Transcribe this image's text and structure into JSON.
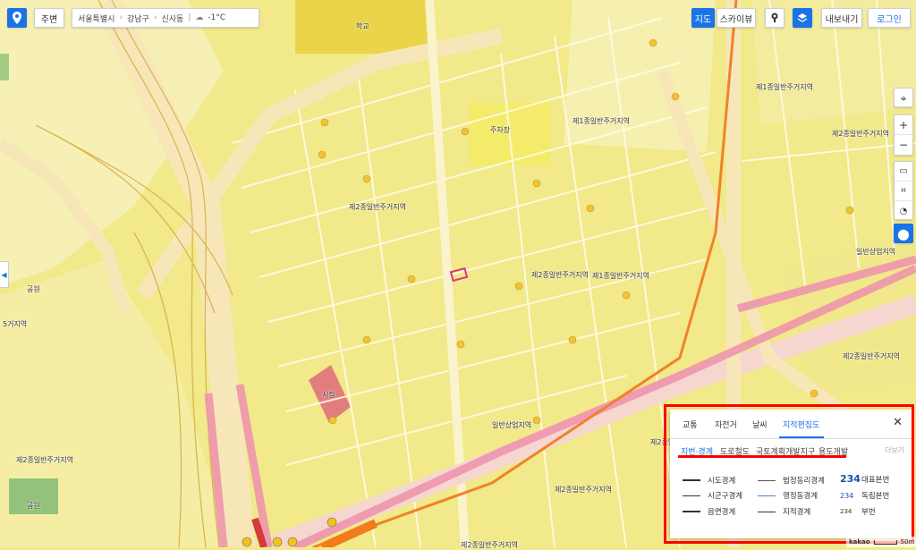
{
  "topbar": {
    "nearby_label": "주변",
    "breadcrumb": [
      "서울특별시",
      "강남구",
      "신사동"
    ],
    "weather": "-1°C",
    "map_label": "지도",
    "skyview_label": "스카이뷰",
    "export_label": "내보내기",
    "login_label": "로그인"
  },
  "map": {
    "labels": {
      "z1": "제1종일반주거지역",
      "z2": "제1종일반주거지역",
      "z3": "제2종일반주거지역",
      "z4": "제2종일반주거지역",
      "z5": "제2종일반주거지역",
      "z6": "제2종일반주거지역",
      "z7": "제2종일반주거지역",
      "z8": "제1종일반주거지역",
      "z9": "일반상업지역",
      "z10": "일반상업지역",
      "z11": "제2종일반주거지역",
      "z12": "제2종일반주거지역",
      "z13": "5거지역",
      "z14": "주차장",
      "z15": "학교",
      "z16": "공원",
      "z17": "공원",
      "z18": "시장",
      "z19": "제2종일반주거지역"
    },
    "scale": "50m",
    "brand": "kakao"
  },
  "panel": {
    "tabs": [
      "교통",
      "자전거",
      "날씨",
      "지적편집도"
    ],
    "active_tab": "지적편집도",
    "subtabs": [
      "지번·경계",
      "도로철도",
      "국토계획개발지구",
      "용도개발"
    ],
    "active_subtab": "지번·경계",
    "more_label": "더보기",
    "legend": [
      {
        "label": "시도경계"
      },
      {
        "label": "시군구경계"
      },
      {
        "label": "읍면경계"
      },
      {
        "label": "법정동리경계"
      },
      {
        "label": "행정동경계"
      },
      {
        "label": "지적경계"
      },
      {
        "num": "234",
        "label": "대표본번"
      },
      {
        "num": "234",
        "label": "독립본번"
      },
      {
        "num": "234",
        "label": "부번"
      }
    ],
    "colors": {
      "accent": "#1a73e8",
      "highlight": "#ff0000"
    }
  }
}
